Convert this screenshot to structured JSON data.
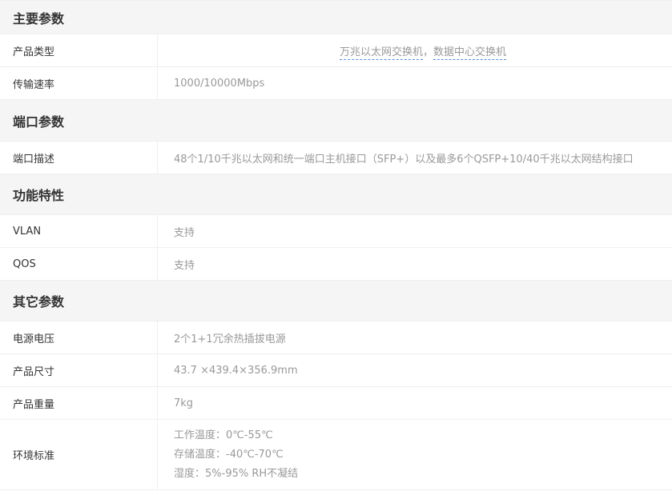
{
  "sections": {
    "main": {
      "title": "主要参数",
      "product_type_label": "产品类型",
      "product_type_link1": "万兆以太网交换机",
      "product_type_sep": "，",
      "product_type_link2": "数据中心交换机",
      "transfer_rate_label": "传输速率",
      "transfer_rate_value": "1000/10000Mbps"
    },
    "port": {
      "title": "端口参数",
      "port_desc_label": "端口描述",
      "port_desc_value": "48个1/10千兆以太网和统一端口主机接口（SFP+）以及最多6个QSFP+10/40千兆以太网结构接口"
    },
    "features": {
      "title": "功能特性",
      "vlan_label": "VLAN",
      "vlan_value": "支持",
      "qos_label": "QOS",
      "qos_value": "支持"
    },
    "other": {
      "title": "其它参数",
      "power_label": "电源电压",
      "power_value": "2个1+1冗余热插拔电源",
      "size_label": "产品尺寸",
      "size_value": "43.7 ×439.4×356.9mm",
      "weight_label": "产品重量",
      "weight_value": "7kg",
      "env_label": "环境标准",
      "env_lines": [
        "工作温度：0℃-55℃",
        "存储温度：-40℃-70℃",
        "湿度：5%-95% RH不凝结"
      ]
    }
  }
}
